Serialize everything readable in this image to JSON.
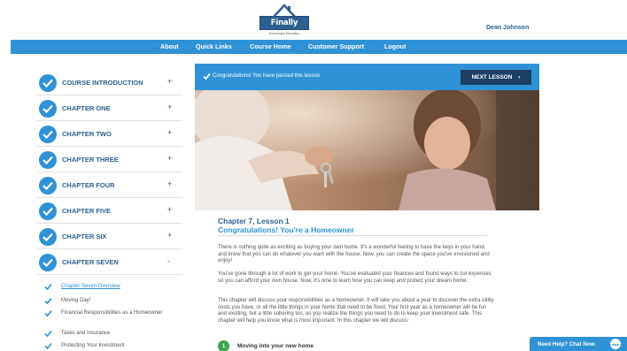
{
  "header": {
    "logo_text": "Finally Home!",
    "logo_tagline": "Homebuyer Education",
    "username": "Dean Johnson"
  },
  "nav": {
    "items": [
      "About",
      "Quick Links",
      "Course Home",
      "Customer Support",
      "Logout"
    ]
  },
  "sidebar": {
    "chapters": [
      {
        "label": "COURSE INTRODUCTION",
        "toggle": "+"
      },
      {
        "label": "CHAPTER ONE",
        "toggle": "+"
      },
      {
        "label": "CHAPTER TWO",
        "toggle": "+"
      },
      {
        "label": "CHAPTER THREE",
        "toggle": "+"
      },
      {
        "label": "CHAPTER FOUR",
        "toggle": "+"
      },
      {
        "label": "CHAPTER FIVE",
        "toggle": "+"
      },
      {
        "label": "CHAPTER SIX",
        "toggle": "+"
      },
      {
        "label": "CHAPTER SEVEN",
        "toggle": "-"
      }
    ],
    "subitems": [
      {
        "label": "Chapter Seven Overview"
      },
      {
        "label": "Moving Day!"
      },
      {
        "label": "Financial Responsibilities as a Homeowner"
      },
      {
        "label": "Taxes and Insurance"
      },
      {
        "label": "Protecting Your Investment"
      }
    ]
  },
  "banner": {
    "message": "Congratulations! You have passed this lesson.",
    "next_label": "NEXT LESSON"
  },
  "lesson": {
    "title": "Chapter 7, Lesson 1",
    "subtitle": "Congratulations! You're a Homeowner",
    "paragraphs": [
      "There is nothing quite as exciting as buying your own home. It's a wonderful feeling to have the keys in your hand, and know that you can do whatever you want with the house. Now, you can create the space you've envisioned and enjoy!",
      "You've gone through a lot of work to get your home. You've evaluated your finances and found ways to cut expenses so you can afford your own house. Now, it's time to learn how you can keep and protect your dream home.",
      "This chapter will discuss your responsibilities as a homeowner. It will take you about a year to discover the extra utility costs you have, or all the little things in your home that need to be fixed. Your first year as a homeowner will be fun and exciting, but a little sobering too, as you realize the things you need to do to keep your investment safe. This chapter will help you know what is most important. In this chapter we will discuss:"
    ],
    "list": [
      {
        "number": "1",
        "label": "Moving into your new home"
      }
    ]
  },
  "chat": {
    "label": "Need Help? Chat Now."
  },
  "colors": {
    "primary": "#2f92d6",
    "dark_navy": "#1d3f66",
    "heading": "#2c5f8f",
    "green": "#3aa64a"
  }
}
